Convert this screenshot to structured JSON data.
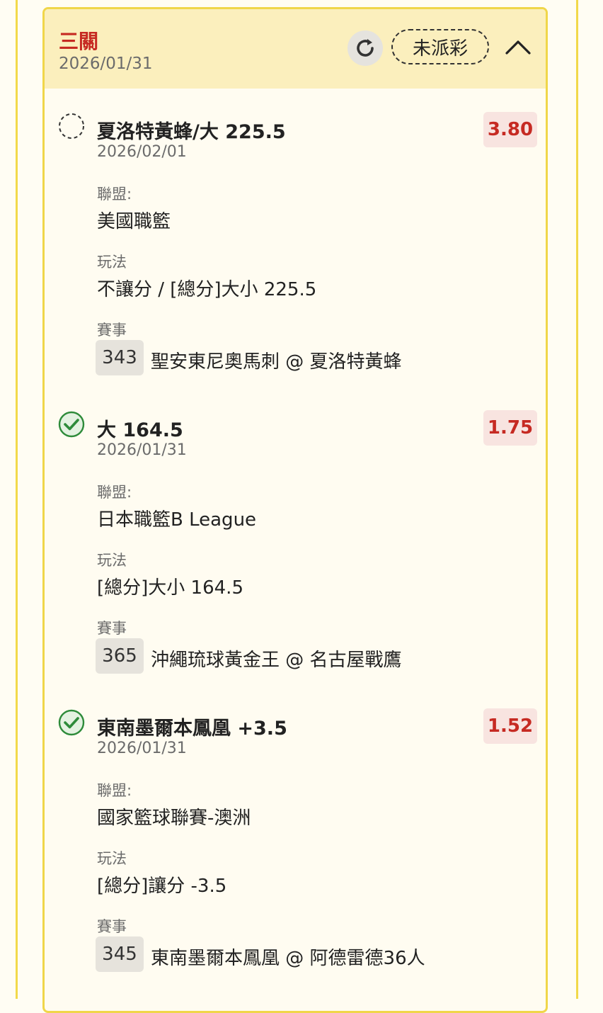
{
  "header": {
    "bet_type": "三關",
    "date": "2026/01/31",
    "status": "未派彩",
    "refresh_icon": "refresh-icon",
    "collapse_icon": "chevron-up-icon"
  },
  "labels": {
    "league": "聯盟:",
    "market": "玩法",
    "event": "賽事"
  },
  "legs": [
    {
      "status": "pending",
      "selection": "夏洛特黃蜂/大 225.5",
      "date": "2026/02/01",
      "odds": "3.80",
      "league": "美國職籃",
      "market": "不讓分 / [總分]大小 225.5",
      "match_no": "343",
      "match": "聖安東尼奧馬刺 @ 夏洛特黃蜂"
    },
    {
      "status": "won",
      "selection": "大 164.5",
      "date": "2026/01/31",
      "odds": "1.75",
      "league": "日本職籃B League",
      "market": "[總分]大小 164.5",
      "match_no": "365",
      "match": "沖繩琉球黃金王 @ 名古屋戰鷹"
    },
    {
      "status": "won",
      "selection": "東南墨爾本鳳凰 +3.5",
      "date": "2026/01/31",
      "odds": "1.52",
      "league": "國家籃球聯賽-澳洲",
      "market": "[總分]讓分 -3.5",
      "match_no": "345",
      "match": "東南墨爾本鳳凰 @ 阿德雷德36人"
    }
  ],
  "colors": {
    "accent_red": "#c62a22",
    "header_bg": "#fbefbd",
    "border_yellow": "#f0d64a",
    "win_green": "#2e8b3a"
  }
}
